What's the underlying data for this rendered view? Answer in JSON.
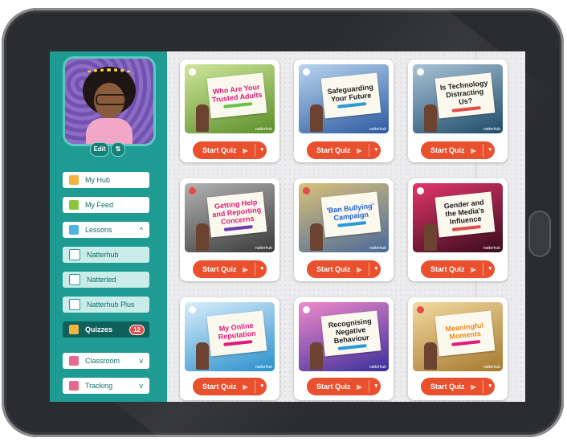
{
  "profile": {
    "edit_label": "Edit",
    "switch_label": "⇅"
  },
  "sidebar": {
    "items": [
      {
        "label": "My Hub"
      },
      {
        "label": "My Feed"
      },
      {
        "label": "Lessons",
        "chevron": "^"
      },
      {
        "label": "Natterhub"
      },
      {
        "label": "Natterled"
      },
      {
        "label": "Natterhub Plus"
      },
      {
        "label": "Quizzes",
        "count": "12"
      },
      {
        "label": "Classroom",
        "chevron": "v"
      },
      {
        "label": "Tracking",
        "chevron": "v"
      }
    ]
  },
  "quiz_button_label": "Start Quiz",
  "play_icon": "▶",
  "dropdown_icon": "▾",
  "brand_text": "natterhub",
  "cards": [
    {
      "title": "Who Are Your Trusted Adults",
      "title_color": "#e0197c",
      "bg": "#5b8f2a"
    },
    {
      "title": "Safeguarding Your Future",
      "title_color": "#1b1b1b",
      "bg": "#5a7fa8"
    },
    {
      "title": "Is Technology Distracting Us?",
      "title_color": "#1b1b1b",
      "bg": "#3b6e8a"
    },
    {
      "title": "Getting Help and Reporting Concerns",
      "title_color": "#e0197c",
      "bg": "#5c5c5c"
    },
    {
      "title": "'Ban Bullying' Campaign",
      "title_color": "#1f5fd0",
      "bg": "#6a7f9a"
    },
    {
      "title": "Gender and the Media's Influence",
      "title_color": "#1b1b1b",
      "bg": "#8a1f3a"
    },
    {
      "title": "My Online Reputation",
      "title_color": "#e0197c",
      "bg": "#4aa7d6"
    },
    {
      "title": "Recognising Negative Behaviour",
      "title_color": "#1b1b1b",
      "bg": "#8a3a9a"
    },
    {
      "title": "Meaningful Moments",
      "title_color": "#f08a1a",
      "bg": "#c7a050"
    }
  ]
}
